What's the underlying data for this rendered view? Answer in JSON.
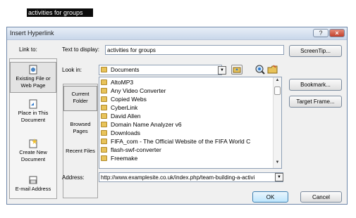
{
  "document": {
    "selected_text": "activities for groups"
  },
  "dialog": {
    "title": "Insert Hyperlink",
    "link_to_label": "Link to:",
    "text_to_display_label": "Text to display:",
    "text_to_display_value": "activities for groups",
    "screentip_button": "ScreenTip...",
    "look_in_label": "Look in:",
    "look_in_value": "Documents",
    "bookmark_button": "Bookmark...",
    "target_frame_button": "Target Frame...",
    "address_label": "Address:",
    "address_value": "http://www.examplesite.co.uk/index.php/team-building-a-activi",
    "ok_button": "OK",
    "cancel_button": "Cancel",
    "link_to_items": [
      {
        "label": "Existing File or Web Page",
        "icon": "page-icon"
      },
      {
        "label": "Place in This Document",
        "icon": "document-place-icon"
      },
      {
        "label": "Create New Document",
        "icon": "new-document-icon"
      },
      {
        "label": "E-mail Address",
        "icon": "email-icon"
      }
    ],
    "sub_nav": [
      {
        "label": "Current Folder"
      },
      {
        "label": "Browsed Pages"
      },
      {
        "label": "Recent Files"
      }
    ],
    "files": [
      "AltoMP3",
      "Any Video Converter",
      "Copied Webs",
      "CyberLink",
      "David Allen",
      "Domain Name Analyzer v6",
      "Downloads",
      "FIFA_com - The Official Website of the FIFA World C",
      "flash-swf-converter",
      "Freemake"
    ],
    "help_glyph": "?",
    "close_glyph": "×"
  }
}
